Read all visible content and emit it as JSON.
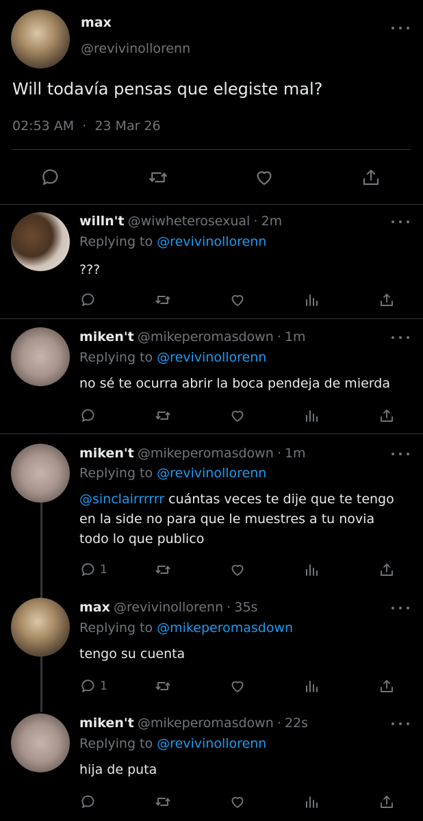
{
  "main": {
    "name": "max",
    "handle": "@revivinollorenn",
    "text": "Will todavía pensas que elegiste mal?",
    "time": "02:53 AM",
    "sep": "·",
    "date": "23 Mar 26"
  },
  "replies": [
    {
      "name": "willn't",
      "handle": "@wiwheterosexual",
      "sep": "·",
      "time": "2m",
      "replying_label": "Replying to",
      "replying_to": "@revivinollorenn",
      "text": "???",
      "reply_count": ""
    },
    {
      "name": "miken't",
      "handle": "@mikeperomasdown",
      "sep": "·",
      "time": "1m",
      "replying_label": "Replying to",
      "replying_to": "@revivinollorenn",
      "text": "no sé te ocurra abrir la boca pendeja de mierda",
      "reply_count": ""
    },
    {
      "name": "miken't",
      "handle": "@mikeperomasdown",
      "sep": "·",
      "time": "1m",
      "replying_label": "Replying to",
      "replying_to": "@revivinollorenn",
      "mention": "@sinclairrrrrr",
      "text_line1": "cuántas veces te dije que te tengo",
      "text_line2": "en la side no para que le muestres a tu novia",
      "text_line3": "todo lo que publico",
      "reply_count": "1"
    },
    {
      "name": "max",
      "handle": "@revivinollorenn",
      "sep": "·",
      "time": "35s",
      "replying_label": "Replying to",
      "replying_to": "@mikeperomasdown",
      "text": "tengo su cuenta",
      "reply_count": "1"
    },
    {
      "name": "miken't",
      "handle": "@mikeperomasdown",
      "sep": "·",
      "time": "22s",
      "replying_label": "Replying to",
      "replying_to": "@revivinollorenn",
      "text": "hija de puta",
      "reply_count": ""
    }
  ],
  "icons": {
    "reply": "reply-icon",
    "retweet": "retweet-icon",
    "like": "heart-icon",
    "analytics": "analytics-icon",
    "share": "share-icon",
    "more": "more-dots-icon"
  },
  "colors": {
    "background": "#000000",
    "text": "#e7e9ea",
    "muted": "#71767b",
    "link": "#1d9bf0",
    "divider": "#2f3336"
  }
}
